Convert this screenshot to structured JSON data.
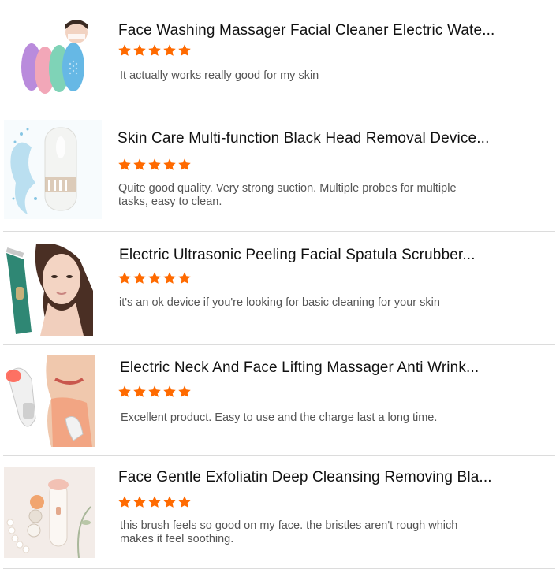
{
  "colors": {
    "star": "#ff6a00",
    "title": "#111111",
    "text": "#555555",
    "divider": "#dcdcdc"
  },
  "reviews": [
    {
      "title": "Face Washing Massager Facial Cleaner Electric Wate...",
      "rating": 5,
      "text": "It actually works really good for my skin",
      "image_icon": "facial-brush-product-image"
    },
    {
      "title": "Skin Care Multi-function Black Head Removal Device...",
      "rating": 5,
      "text": "Quite good quality. Very strong suction. Multiple probes for multiple tasks, easy to clean.",
      "image_icon": "blackhead-device-product-image"
    },
    {
      "title": "Electric Ultrasonic Peeling Facial Spatula Scrubber...",
      "rating": 5,
      "text": "it's an ok device if you're looking for basic cleaning for your skin",
      "image_icon": "ultrasonic-spatula-product-image"
    },
    {
      "title": "Electric Neck And Face Lifting Massager Anti Wrink...",
      "rating": 5,
      "text": "Excellent product. Easy to use and the charge last a long time.",
      "image_icon": "neck-massager-product-image"
    },
    {
      "title": "Face Gentle Exfoliatin Deep Cleansing Removing Bla...",
      "rating": 5,
      "text": "this brush feels so good on my face. the bristles aren't rough which makes it feel soothing.",
      "image_icon": "cleansing-brush-product-image"
    }
  ]
}
